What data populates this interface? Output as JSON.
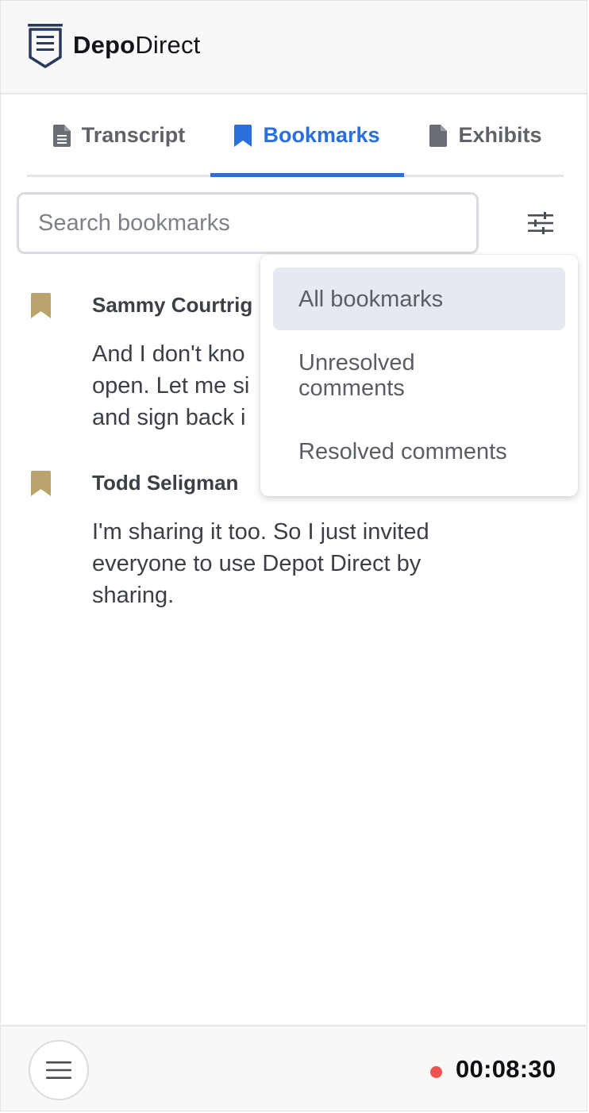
{
  "header": {
    "logo_icon": "depodirect-logo-icon",
    "brand_bold": "Depo",
    "brand_regular": "Direct"
  },
  "tabs": [
    {
      "label": "Transcript",
      "icon": "file-text-icon",
      "active": false
    },
    {
      "label": "Bookmarks",
      "icon": "bookmark-icon",
      "active": true
    },
    {
      "label": "Exhibits",
      "icon": "file-icon",
      "active": false
    }
  ],
  "colors": {
    "accent": "#2a6fdc",
    "bookmark": "#b9a46b",
    "recording": "#ef5350"
  },
  "search": {
    "placeholder": "Search bookmarks",
    "value": ""
  },
  "filter": {
    "icon": "sliders-icon"
  },
  "bookmarks": [
    {
      "speaker": "Sammy Courtrig",
      "text": "And I don't kno\nopen. Let me si\nand sign back i"
    },
    {
      "speaker": "Todd Seligman",
      "text": "I'm sharing it too. So I just invited everyone to use Depot Direct by sharing."
    }
  ],
  "filter_menu": {
    "options": [
      "All bookmarks",
      "Unresolved comments",
      "Resolved comments"
    ],
    "selected": "All bookmarks"
  },
  "footer": {
    "menu_icon": "hamburger-icon",
    "recording_indicator": "recording-dot",
    "timer": "00:08:30"
  }
}
